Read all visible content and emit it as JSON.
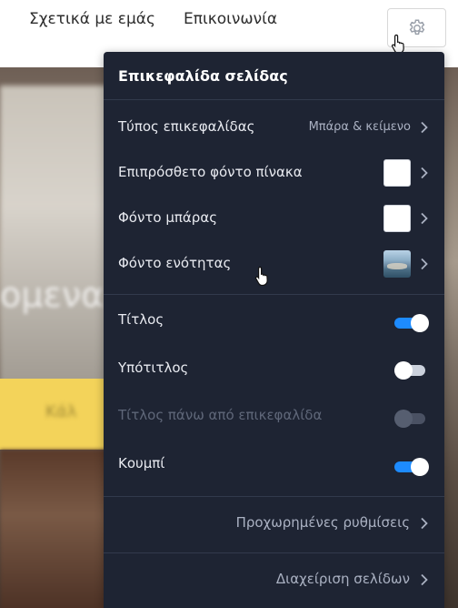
{
  "nav": {
    "about": "Σχετικά με εμάς",
    "contact": "Επικοινωνία"
  },
  "background": {
    "blurred_text": "ομενα",
    "yellow_button_text": "Κάλ"
  },
  "panel": {
    "title": "Επικεφαλίδα σελίδας",
    "rows": {
      "header_type": {
        "label": "Τύπος επικεφαλίδας",
        "value": "Μπάρα & κείμενο"
      },
      "board_bg": {
        "label": "Επιπρόσθετο φόντο πίνακα",
        "swatch": "#ffffff"
      },
      "bar_bg": {
        "label": "Φόντο μπάρας",
        "swatch": "#ffffff"
      },
      "section_bg": {
        "label": "Φόντο ενότητας"
      },
      "title": {
        "label": "Τίτλος",
        "on": true
      },
      "subtitle": {
        "label": "Υπότιτλος",
        "on": false
      },
      "title_above": {
        "label": "Τίτλος πάνω από επικεφαλίδα",
        "on": false,
        "disabled": true
      },
      "button": {
        "label": "Κουμπί",
        "on": true
      }
    },
    "advanced": "Προχωρημένες ρυθμίσεις",
    "manage_pages": "Διαχείριση σελίδων"
  },
  "colors": {
    "panel_bg": "#1e2433",
    "toggle_on": "#1d8bff",
    "accent_yellow": "#f3d35a"
  }
}
